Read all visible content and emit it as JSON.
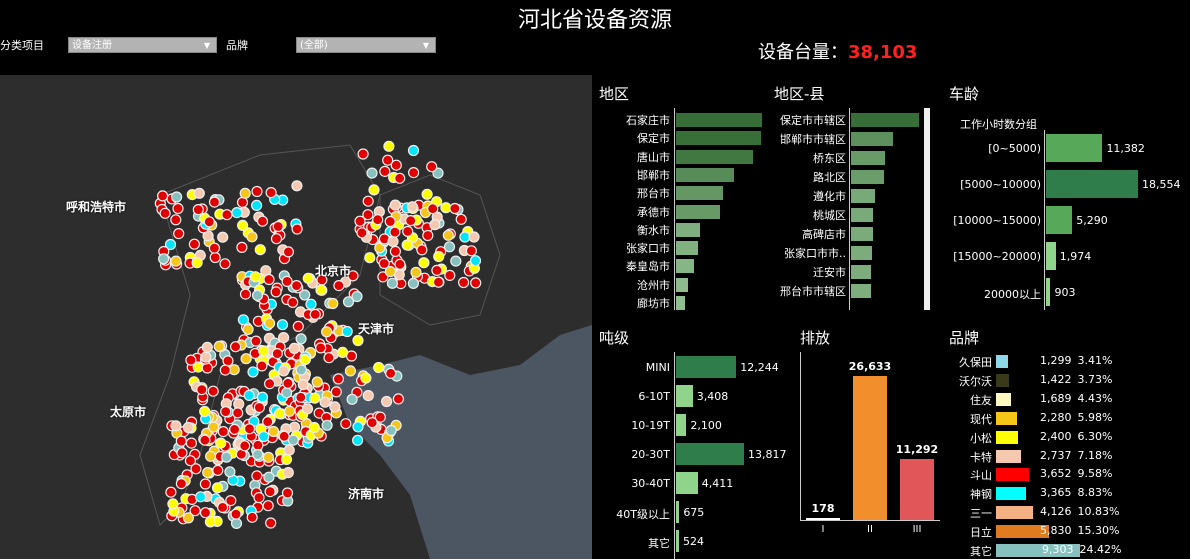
{
  "title": "河北省设备资源",
  "filters": {
    "category_label": "分类项目",
    "category_value": "设备注册",
    "brand_label": "品牌",
    "brand_value": "(全部)"
  },
  "kpi": {
    "label": "设备台量：",
    "value": "38,103"
  },
  "map": {
    "cities": [
      "呼和浩特市",
      "北京市",
      "天津市",
      "太原市",
      "济南市"
    ]
  },
  "region": {
    "title": "地区",
    "items": [
      {
        "label": "石家庄市",
        "value": 1.0
      },
      {
        "label": "保定市",
        "value": 0.99
      },
      {
        "label": "唐山市",
        "value": 0.9
      },
      {
        "label": "邯郸市",
        "value": 0.68
      },
      {
        "label": "邢台市",
        "value": 0.55
      },
      {
        "label": "承德市",
        "value": 0.51
      },
      {
        "label": "衡水市",
        "value": 0.28
      },
      {
        "label": "张家口市",
        "value": 0.25
      },
      {
        "label": "秦皇岛市",
        "value": 0.21
      },
      {
        "label": "沧州市",
        "value": 0.14
      },
      {
        "label": "廊坊市",
        "value": 0.11
      }
    ]
  },
  "county": {
    "title": "地区-县",
    "items": [
      {
        "label": "保定市市辖区",
        "value": 1.0
      },
      {
        "label": "邯郸市市辖区",
        "value": 0.62
      },
      {
        "label": "桥东区",
        "value": 0.5
      },
      {
        "label": "路北区",
        "value": 0.48
      },
      {
        "label": "遵化市",
        "value": 0.35
      },
      {
        "label": "桃城区",
        "value": 0.33
      },
      {
        "label": "高碑店市",
        "value": 0.32
      },
      {
        "label": "张家口市市..",
        "value": 0.31
      },
      {
        "label": "迁安市",
        "value": 0.3
      },
      {
        "label": "邢台市市辖区",
        "value": 0.29
      }
    ]
  },
  "age": {
    "title": "车龄",
    "subtitle": "工作小时数分组",
    "items": [
      {
        "label": "[0~5000)",
        "value": 11382,
        "display": "11,382"
      },
      {
        "label": "[5000~10000)",
        "value": 18554,
        "display": "18,554"
      },
      {
        "label": "[10000~15000)",
        "value": 5290,
        "display": "5,290"
      },
      {
        "label": "[15000~20000)",
        "value": 1974,
        "display": "1,974"
      },
      {
        "label": "20000以上",
        "value": 903,
        "display": "903"
      }
    ]
  },
  "tonnage": {
    "title": "吨级",
    "items": [
      {
        "label": "MINI",
        "value": 12244,
        "display": "12,244"
      },
      {
        "label": "6-10T",
        "value": 3408,
        "display": "3,408"
      },
      {
        "label": "10-19T",
        "value": 2100,
        "display": "2,100"
      },
      {
        "label": "20-30T",
        "value": 13817,
        "display": "13,817"
      },
      {
        "label": "30-40T",
        "value": 4411,
        "display": "4,411"
      },
      {
        "label": "40T级以上",
        "value": 675,
        "display": "675"
      },
      {
        "label": "其它",
        "value": 524,
        "display": "524"
      }
    ]
  },
  "emission": {
    "title": "排放",
    "items": [
      {
        "label": "I",
        "value": 178,
        "display": "178",
        "color": "#ffffff"
      },
      {
        "label": "II",
        "value": 26633,
        "display": "26,633",
        "color": "#f28e2b"
      },
      {
        "label": "III",
        "value": 11292,
        "display": "11,292",
        "color": "#e15759"
      }
    ]
  },
  "brand": {
    "title": "品牌",
    "items": [
      {
        "label": "久保田",
        "count": "1,299",
        "pct": "3.41%",
        "value": 3.41,
        "color": "#8fd7e8"
      },
      {
        "label": "沃尔沃",
        "count": "1,422",
        "pct": "3.73%",
        "value": 3.73,
        "color": "#3a3a1a"
      },
      {
        "label": "住友",
        "count": "1,689",
        "pct": "4.43%",
        "value": 4.43,
        "color": "#fff8c0"
      },
      {
        "label": "现代",
        "count": "2,280",
        "pct": "5.98%",
        "value": 5.98,
        "color": "#f5c518"
      },
      {
        "label": "小松",
        "count": "2,400",
        "pct": "6.30%",
        "value": 6.3,
        "color": "#ffff00"
      },
      {
        "label": "卡特",
        "count": "2,737",
        "pct": "7.18%",
        "value": 7.18,
        "color": "#f4c9b0"
      },
      {
        "label": "斗山",
        "count": "3,652",
        "pct": "9.58%",
        "value": 9.58,
        "color": "#ff0000"
      },
      {
        "label": "神钢",
        "count": "3,365",
        "pct": "8.83%",
        "value": 8.83,
        "color": "#00ffff"
      },
      {
        "label": "三一",
        "count": "4,126",
        "pct": "10.83%",
        "value": 10.83,
        "color": "#f4b183"
      },
      {
        "label": "日立",
        "count": "5,830",
        "pct": "15.30%",
        "value": 15.3,
        "color": "#e07b20"
      },
      {
        "label": "其它",
        "count": "9,303",
        "pct": "24.42%",
        "value": 24.42,
        "color": "#86c1c0"
      }
    ]
  }
}
